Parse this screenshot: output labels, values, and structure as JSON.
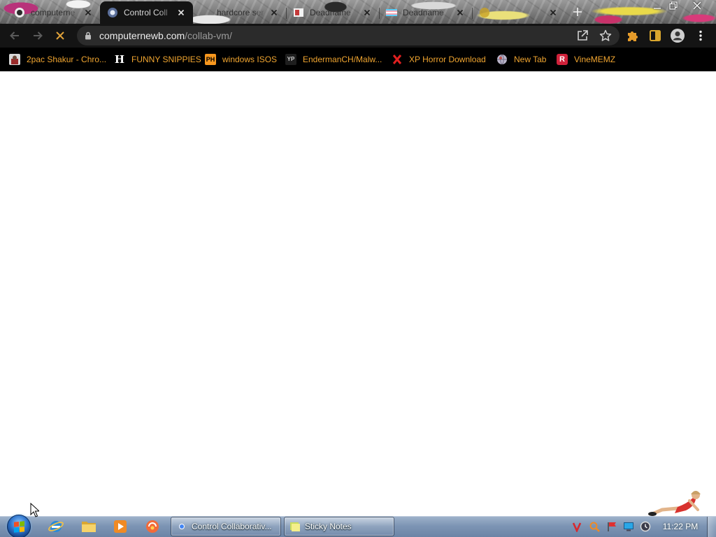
{
  "tabs": [
    {
      "title": "computerne",
      "favicon": "computernewb-favicon-icon",
      "active": false
    },
    {
      "title": "Control Coll",
      "favicon": "collabvm-favicon-icon",
      "active": true
    },
    {
      "title": "hardcore ser",
      "favicon": "",
      "active": false
    },
    {
      "title": "Deadname",
      "favicon": "image-favicon-icon",
      "active": false
    },
    {
      "title": "Deadname",
      "favicon": "trans-flag-favicon-icon",
      "active": false
    },
    {
      "title": "",
      "favicon": "yellow-favicon-icon",
      "active": false
    }
  ],
  "tabstrip_icons": {
    "new_tab": "plus-icon",
    "tab_close": "close-icon"
  },
  "window_controls": [
    "minimize-icon",
    "restore-icon",
    "close-icon"
  ],
  "toolbar": {
    "url_host": "computernewb.com",
    "url_path": "/collab-vm/",
    "icons": [
      "back-arrow-icon",
      "forward-arrow-icon",
      "stop-loading-icon",
      "lock-icon",
      "share-icon",
      "star-icon",
      "extensions-puzzle-icon",
      "side-panel-icon",
      "profile-avatar-icon",
      "more-menu-icon"
    ]
  },
  "bookmarks": [
    {
      "label": "2pac Shakur - Chro...",
      "icon": "photo-icon"
    },
    {
      "label": "FUNNY SNIPPIES",
      "icon": "h-logo-icon",
      "icon_text": "H"
    },
    {
      "label": "windows ISOS",
      "icon": "ph-logo-icon",
      "icon_text": "PH"
    },
    {
      "label": "EndermanCH/Malw...",
      "icon": "yp-logo-icon",
      "icon_text": "YP"
    },
    {
      "label": "XP Horror Download",
      "icon": "red-x-icon"
    },
    {
      "label": "New Tab",
      "icon": "globe-icon"
    },
    {
      "label": "VineMEMZ",
      "icon": "vine-r-logo-icon",
      "icon_text": "R"
    }
  ],
  "taskbar": {
    "start": "windows-start-orb-icon",
    "pinned": [
      "internet-explorer-icon",
      "windows-explorer-icon",
      "media-player-icon",
      "app-icon"
    ],
    "buttons": [
      {
        "label": "Control Collaborativ...",
        "icon": "chrome-icon"
      },
      {
        "label": "Sticky Notes",
        "icon": "sticky-notes-icon"
      }
    ],
    "tray_icons": [
      "red-v-icon",
      "magnifier-icon",
      "action-center-flag-icon",
      "network-monitor-icon",
      "dark-clock-icon"
    ],
    "clock": "11:22 PM"
  },
  "colors": {
    "bookmark_text": "#f0a530",
    "toolbar_bg": "#141414",
    "omnibox_bg": "#2b2b2b",
    "toolbar_accent": "#e39a2a",
    "page_bg": "#ffffff",
    "taskbar": "#7d95b4"
  }
}
